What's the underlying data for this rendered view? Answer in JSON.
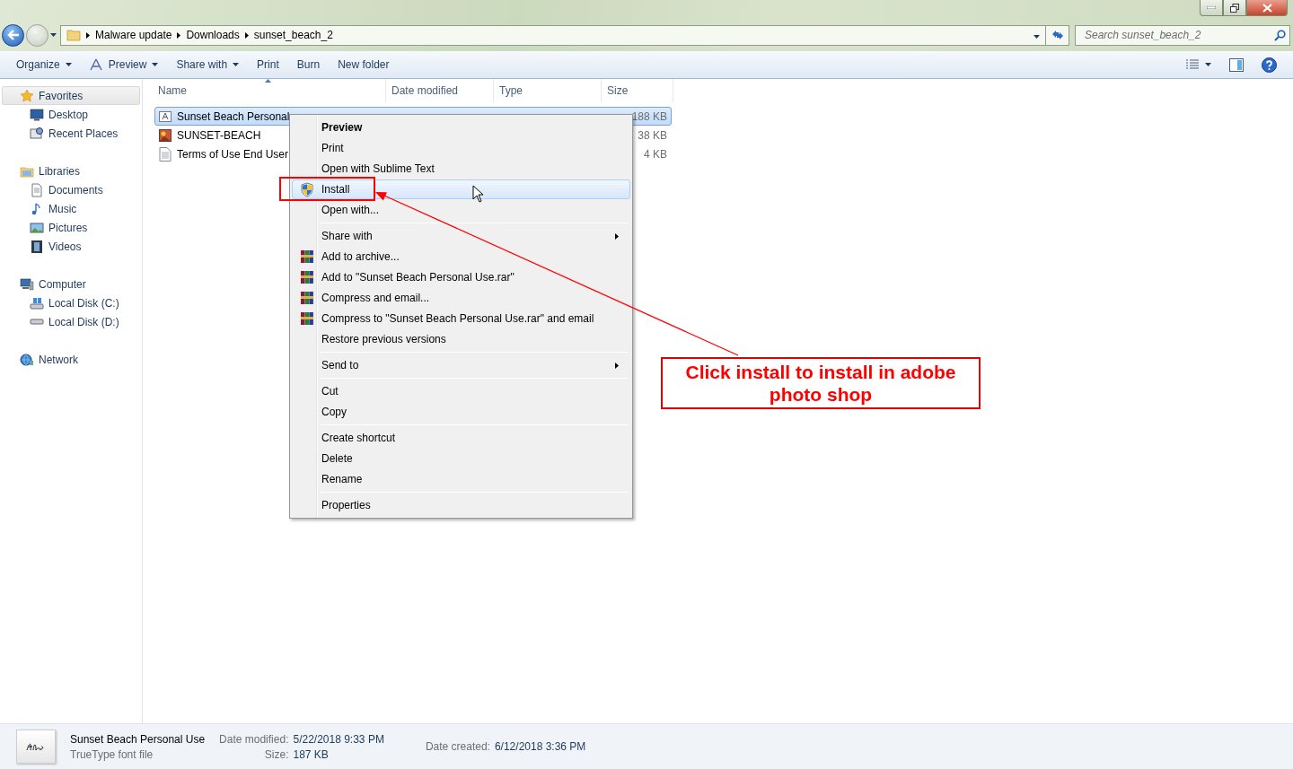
{
  "address": {
    "breadcrumbs": [
      "Malware update",
      "Downloads",
      "sunset_beach_2"
    ]
  },
  "search": {
    "placeholder": "Search sunset_beach_2"
  },
  "toolbar": [
    {
      "label": "Organize",
      "kind": "plain",
      "has_dropdown": true
    },
    {
      "label": "Preview",
      "kind": "preview",
      "has_dropdown": true
    },
    {
      "label": "Share with",
      "kind": "plain",
      "has_dropdown": true
    },
    {
      "label": "Print",
      "kind": "plain",
      "has_dropdown": false
    },
    {
      "label": "Burn",
      "kind": "plain",
      "has_dropdown": false
    },
    {
      "label": "New folder",
      "kind": "plain",
      "has_dropdown": false
    }
  ],
  "sidebar": [
    {
      "label": "Favorites",
      "kind": "star",
      "selected": true,
      "children": [
        {
          "label": "Desktop",
          "kind": "desktop",
          "selected": false
        },
        {
          "label": "Recent Places",
          "kind": "recent",
          "selected": false
        }
      ]
    },
    {
      "label": "Libraries",
      "kind": "library",
      "selected": false,
      "children": [
        {
          "label": "Documents",
          "kind": "document",
          "selected": false
        },
        {
          "label": "Music",
          "kind": "music",
          "selected": false
        },
        {
          "label": "Pictures",
          "kind": "picture",
          "selected": false
        },
        {
          "label": "Videos",
          "kind": "video",
          "selected": false
        }
      ]
    },
    {
      "label": "Computer",
      "kind": "computer",
      "selected": false,
      "children": [
        {
          "label": "Local Disk (C:)",
          "kind": "disk-system",
          "selected": false
        },
        {
          "label": "Local Disk (D:)",
          "kind": "disk",
          "selected": false
        }
      ]
    },
    {
      "label": "Network",
      "kind": "network",
      "selected": false
    }
  ],
  "columns": [
    {
      "label": "Name",
      "sorted": true
    },
    {
      "label": "Date modified",
      "sorted": false
    },
    {
      "label": "Type",
      "sorted": false
    },
    {
      "label": "Size",
      "sorted": false
    }
  ],
  "files": [
    {
      "name": "Sunset Beach Personal",
      "kind": "font",
      "size": "188 KB",
      "selected": true
    },
    {
      "name": "SUNSET-BEACH",
      "kind": "image",
      "size": "38 KB",
      "selected": false
    },
    {
      "name": "Terms of Use End User",
      "kind": "text",
      "size": "4 KB",
      "selected": false
    }
  ],
  "context_menu": {
    "groups": [
      [
        {
          "label": "Preview",
          "kind": "plain",
          "default": true,
          "has_submenu": false,
          "selected": false
        },
        {
          "label": "Print",
          "kind": "plain",
          "default": false,
          "has_submenu": false,
          "selected": false
        },
        {
          "label": "Open with Sublime Text",
          "kind": "plain",
          "default": false,
          "has_submenu": false,
          "selected": false
        },
        {
          "label": "Install",
          "kind": "shield",
          "default": false,
          "has_submenu": false,
          "selected": true
        },
        {
          "label": "Open with...",
          "kind": "plain",
          "default": false,
          "has_submenu": false,
          "selected": false
        }
      ],
      [
        {
          "label": "Share with",
          "kind": "plain",
          "default": false,
          "has_submenu": true,
          "selected": false
        },
        {
          "label": "Add to archive...",
          "kind": "archive",
          "default": false,
          "has_submenu": false,
          "selected": false
        },
        {
          "label": "Add to \"Sunset Beach Personal Use.rar\"",
          "kind": "archive",
          "default": false,
          "has_submenu": false,
          "selected": false
        },
        {
          "label": "Compress and email...",
          "kind": "archive",
          "default": false,
          "has_submenu": false,
          "selected": false
        },
        {
          "label": "Compress to \"Sunset Beach Personal Use.rar\" and email",
          "kind": "archive",
          "default": false,
          "has_submenu": false,
          "selected": false
        },
        {
          "label": "Restore previous versions",
          "kind": "plain",
          "default": false,
          "has_submenu": false,
          "selected": false
        }
      ],
      [
        {
          "label": "Send to",
          "kind": "plain",
          "default": false,
          "has_submenu": true,
          "selected": false
        }
      ],
      [
        {
          "label": "Cut",
          "kind": "plain",
          "default": false,
          "has_submenu": false,
          "selected": false
        },
        {
          "label": "Copy",
          "kind": "plain",
          "default": false,
          "has_submenu": false,
          "selected": false
        }
      ],
      [
        {
          "label": "Create shortcut",
          "kind": "plain",
          "default": false,
          "has_submenu": false,
          "selected": false
        },
        {
          "label": "Delete",
          "kind": "plain",
          "default": false,
          "has_submenu": false,
          "selected": false
        },
        {
          "label": "Rename",
          "kind": "plain",
          "default": false,
          "has_submenu": false,
          "selected": false
        }
      ],
      [
        {
          "label": "Properties",
          "kind": "plain",
          "default": false,
          "has_submenu": false,
          "selected": false
        }
      ]
    ]
  },
  "annotation": {
    "text": "Click install to install in adobe photo shop"
  },
  "details": {
    "name": "Sunset Beach Personal Use",
    "type": "TrueType font file",
    "columns": [
      [
        {
          "label": "Date modified:",
          "value": "5/22/2018 9:33 PM"
        },
        {
          "label": "Size:",
          "value": "187 KB"
        }
      ],
      [
        {
          "label": "Date created:",
          "value": "6/12/2018 3:36 PM"
        }
      ]
    ]
  }
}
